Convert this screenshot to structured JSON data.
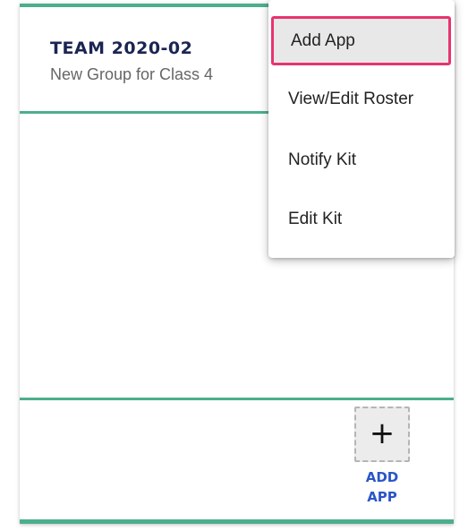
{
  "team": {
    "title": "TEAM 2020-02",
    "subtitle": "New Group for Class 4"
  },
  "add_app_tile": {
    "icon": "plus-icon",
    "icon_glyph": "+",
    "label": "ADD APP"
  },
  "menu": {
    "items": [
      {
        "label": "Add App",
        "highlighted": true
      },
      {
        "label": "View/Edit Roster"
      },
      {
        "label": "Notify Kit"
      },
      {
        "label": "Edit Kit"
      }
    ]
  },
  "colors": {
    "accent_green": "#4caf8b",
    "title_navy": "#1a2552",
    "add_app_blue": "#2a56c6",
    "highlight_border": "#e8336e"
  }
}
